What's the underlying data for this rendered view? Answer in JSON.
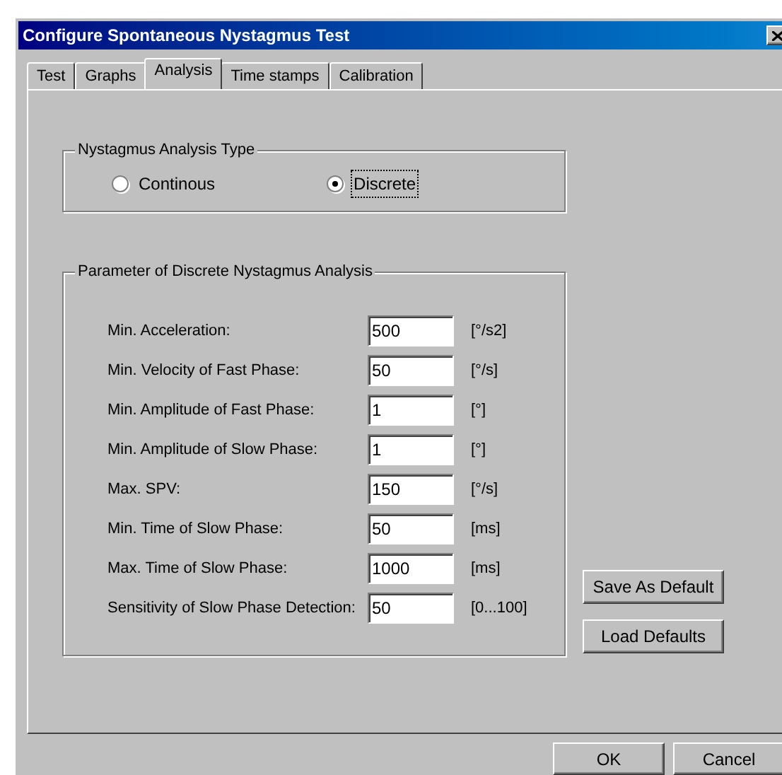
{
  "window": {
    "title": "Configure Spontaneous Nystagmus Test"
  },
  "tabs": [
    {
      "label": "Test",
      "selected": false
    },
    {
      "label": "Graphs",
      "selected": false
    },
    {
      "label": "Analysis",
      "selected": true
    },
    {
      "label": "Time stamps",
      "selected": false
    },
    {
      "label": "Calibration",
      "selected": false
    }
  ],
  "analysis_type": {
    "title": "Nystagmus Analysis Type",
    "options": [
      {
        "label": "Continous",
        "selected": false
      },
      {
        "label": "Discrete",
        "selected": true
      }
    ]
  },
  "parameters": {
    "title": "Parameter of Discrete Nystagmus Analysis",
    "rows": [
      {
        "label": "Min. Acceleration:",
        "value": "500",
        "unit": "[°/s2]"
      },
      {
        "label": "Min. Velocity of Fast Phase:",
        "value": "50",
        "unit": "[°/s]"
      },
      {
        "label": "Min. Amplitude of Fast Phase:",
        "value": "1",
        "unit": "[°]"
      },
      {
        "label": "Min. Amplitude of Slow Phase:",
        "value": "1",
        "unit": "[°]"
      },
      {
        "label": "Max. SPV:",
        "value": "150",
        "unit": "[°/s]"
      },
      {
        "label": "Min. Time of Slow Phase:",
        "value": "50",
        "unit": "[ms]"
      },
      {
        "label": "Max. Time of Slow Phase:",
        "value": "1000",
        "unit": "[ms]"
      },
      {
        "label": "Sensitivity of Slow Phase Detection:",
        "value": "50",
        "unit": "[0...100]"
      }
    ]
  },
  "side_buttons": [
    "Save As Default",
    "Load Defaults"
  ],
  "buttons": [
    "OK",
    "Cancel"
  ]
}
